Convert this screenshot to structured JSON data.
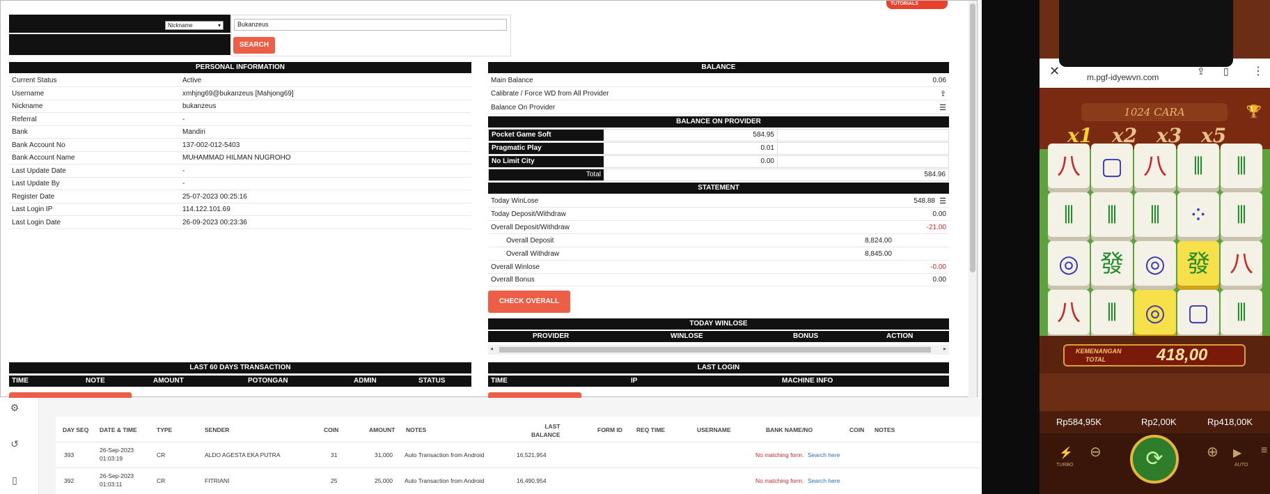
{
  "search": {
    "field_select": "Nickname",
    "query_value": "Bukanzeus",
    "search_label": "SEARCH",
    "tutorials_label": "TUTORIALS"
  },
  "personal": {
    "title": "PERSONAL INFORMATION",
    "rows": [
      {
        "k": "Current Status",
        "v": "Active"
      },
      {
        "k": "Username",
        "v": "xmhjng69@bukanzeus  [Mahjong69]"
      },
      {
        "k": "Nickname",
        "v": "bukanzeus"
      },
      {
        "k": "Referral",
        "v": "-"
      },
      {
        "k": "Bank",
        "v": "Mandiri"
      },
      {
        "k": "Bank Account No",
        "v": "137-002-012-5403"
      },
      {
        "k": "Bank Account Name",
        "v": "MUHAMMAD HILMAN NUGROHO"
      },
      {
        "k": "Last Update Date",
        "v": "-"
      },
      {
        "k": "Last Update By",
        "v": "-"
      },
      {
        "k": "Register Date",
        "v": "25-07-2023 00:25:16"
      },
      {
        "k": "Last Login IP",
        "v": "114.122.101.69"
      },
      {
        "k": "Last Login Date",
        "v": "26-09-2023 00:23:36"
      }
    ]
  },
  "balance": {
    "title": "BALANCE",
    "main_label": "Main Balance",
    "main_value": "0.06",
    "calibrate_label": "Calibrate / Force WD from All Provider",
    "on_provider_label": "Balance On Provider"
  },
  "provider": {
    "title": "BALANCE ON PROVIDER",
    "rows": [
      {
        "name": "Pocket Game Soft",
        "value": "584.95"
      },
      {
        "name": "Pragmatic Play",
        "value": "0.01"
      },
      {
        "name": "No Limit City",
        "value": "0.00"
      }
    ],
    "total_label": "Total",
    "total_value": "584.96"
  },
  "statement": {
    "title": "STATEMENT",
    "today_winlose_label": "Today WinLose",
    "today_winlose_value": "548.88",
    "today_dw_label": "Today Deposit/Withdraw",
    "today_dw_value": "0.00",
    "overall_dw_label": "Overall Deposit/Withdraw",
    "overall_dw_value": "-21.00",
    "overall_deposit_label": "Overall Deposit",
    "overall_deposit_value": "8,824.00",
    "overall_withdraw_label": "Overall Withdraw",
    "overall_withdraw_value": "8,845.00",
    "overall_winlose_label": "Overall Winlose",
    "overall_winlose_value": "-0.00",
    "overall_bonus_label": "Overall Bonus",
    "overall_bonus_value": "0.00",
    "check_overall_label": "CHECK OVERALL"
  },
  "today_winlose": {
    "title": "TODAY WINLOSE",
    "columns": [
      "PROVIDER",
      "WINLOSE",
      "BONUS",
      "ACTION"
    ]
  },
  "last60": {
    "title": "LAST 60 DAYS TRANSACTION",
    "columns": [
      "TIME",
      "NOTE",
      "AMOUNT",
      "POTONGAN",
      "ADMIN",
      "STATUS"
    ]
  },
  "last_login": {
    "title": "LAST LOGIN",
    "columns": [
      "TIME",
      "IP",
      "MACHINE INFO"
    ]
  },
  "bg_table": {
    "headers": [
      "DAY SEQ",
      "DATE & TIME",
      "TYPE",
      "SENDER",
      "COIN",
      "AMOUNT",
      "NOTES",
      "LAST\nBALANCE",
      "FORM ID",
      "REQ TIME",
      "USERNAME",
      "BANK NAME/NO",
      "COIN",
      "NOTES"
    ],
    "rows": [
      {
        "seq": "393",
        "date": "26-Sep-2023",
        "time": "01:03:19",
        "type": "CR",
        "sender": "ALDO AGESTA EKA PUTRA",
        "coin": "31",
        "amount": "31,000",
        "notes": "Auto Transaction from Android",
        "last_balance": "16,521,954",
        "match": "No matching form.",
        "search": "Search here"
      },
      {
        "seq": "392",
        "date": "26-Sep-2023",
        "time": "01:03:11",
        "type": "CR",
        "sender": "FITRIANI",
        "coin": "25",
        "amount": "25,000",
        "notes": "Auto Transaction from Android",
        "last_balance": "16,490,954",
        "match": "No matching form.",
        "search": "Search here"
      }
    ]
  },
  "phone": {
    "url": "m.pgf-idyewvn.com",
    "game_title": "1024 CARA",
    "multipliers": [
      "x1",
      "x2",
      "x3",
      "x5"
    ],
    "win_label_1": "KEMENANGAN",
    "win_label_2": "TOTAL",
    "win_value": "418,00",
    "balance": "Rp584,95K",
    "bet": "Rp2,00K",
    "win": "Rp418,00K",
    "turbo": "TURBO",
    "auto": "AUTO"
  }
}
